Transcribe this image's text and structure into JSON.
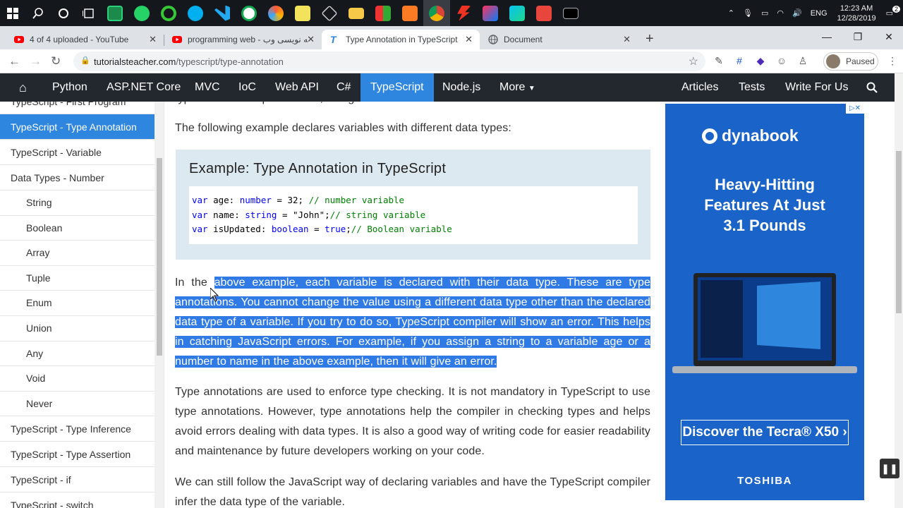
{
  "taskbar": {
    "apps": [
      "start",
      "search",
      "cortana",
      "task-view",
      "app-green",
      "whatsapp",
      "app-ring",
      "skype",
      "vscode",
      "app-leaf",
      "app-blue",
      "app-paper",
      "app-cube",
      "file-explorer",
      "app-tiles",
      "xampp",
      "chrome",
      "app-red",
      "intellij",
      "webstorm",
      "app-orange",
      "terminal"
    ],
    "tray": {
      "lang": "ENG",
      "time": "12:23 AM",
      "date": "12/28/2019",
      "notif_count": "2"
    }
  },
  "browser": {
    "tabs": [
      {
        "title": "4 of 4 uploaded - YouTube",
        "icon": "youtube-icon"
      },
      {
        "title": "programming web - آموزش برنامه نویسی وب",
        "icon": "youtube-icon"
      },
      {
        "title": "Type Annotation in TypeScript",
        "icon": "tutorialsteacher-icon",
        "active": true
      },
      {
        "title": "Document",
        "icon": "globe-icon"
      }
    ],
    "url_host": "tutorialsteacher.com",
    "url_path": "/typescript/type-annotation",
    "profile_status": "Paused"
  },
  "sitenav": {
    "items": [
      "Python",
      "ASP.NET Core",
      "MVC",
      "IoC",
      "Web API",
      "C#",
      "TypeScript",
      "Node.js",
      "More"
    ],
    "right_items": [
      "Articles",
      "Tests",
      "Write For Us"
    ]
  },
  "sidebar": {
    "items": [
      {
        "label": "TypeScript - First Program"
      },
      {
        "label": "TypeScript - Type Annotation",
        "active": true
      },
      {
        "label": "TypeScript - Variable"
      },
      {
        "label": "Data Types - Number"
      },
      {
        "label": "String",
        "sub": true
      },
      {
        "label": "Boolean",
        "sub": true
      },
      {
        "label": "Array",
        "sub": true
      },
      {
        "label": "Tuple",
        "sub": true
      },
      {
        "label": "Enum",
        "sub": true
      },
      {
        "label": "Union",
        "sub": true
      },
      {
        "label": "Any",
        "sub": true
      },
      {
        "label": "Void",
        "sub": true
      },
      {
        "label": "Never",
        "sub": true
      },
      {
        "label": "TypeScript - Type Inference"
      },
      {
        "label": "TypeScript - Type Assertion"
      },
      {
        "label": "TypeScript - if"
      },
      {
        "label": "TypeScript - switch"
      }
    ]
  },
  "content": {
    "top_cut": "types of JavaScript - number, string and boolean.",
    "intro": "The following example declares variables with different data types:",
    "example_title": "Example: Type Annotation in TypeScript",
    "code": [
      {
        "kw": "var",
        "name": " age: ",
        "type": "number",
        "eq": " = ",
        "val": "32",
        "end": "; ",
        "comment": "// number variable"
      },
      {
        "kw": "var",
        "name": " name: ",
        "type": "string",
        "eq": " = ",
        "val": "\"John\"",
        "end": ";",
        "comment": "// string variable"
      },
      {
        "kw": "var",
        "name": " isUpdated: ",
        "type": "boolean",
        "eq": " = ",
        "val": "true",
        "end": ";",
        "comment": "// Boolean variable"
      }
    ],
    "p1_lead": "In the ",
    "p1_selected": "above example, each variable is declared with their data type. These are type annotations. You cannot change the value using a different data type other than the declared data type of a variable. If you try to do so, TypeScript compiler will show an error. This helps in catching JavaScript errors. For example, if you assign a string to a variable age or a number to name in the above example, then it will give an error.",
    "p2": "Type annotations are used to enforce type checking. It is not mandatory in TypeScript to use type annotations. However, type annotations help the compiler in checking types and helps avoid errors dealing with data types. It is also a good way of writing code for easier readability and maintenance by future developers working on your code.",
    "p3": "We can still follow the JavaScript way of declaring variables and have the TypeScript compiler infer the data type of the variable."
  },
  "ad": {
    "brand": "dynabook",
    "headline": "Heavy-Hitting Features At Just 3.1 Pounds",
    "cta": "Discover the Tecra® X50 ›",
    "maker": "TOSHIBA",
    "colors": {
      "bg": "#1a63c8"
    }
  },
  "colors": {
    "nav_bg": "#23282f",
    "accent": "#2e86de",
    "selection": "#2f7ae5",
    "example_bg": "#dde9f1"
  }
}
